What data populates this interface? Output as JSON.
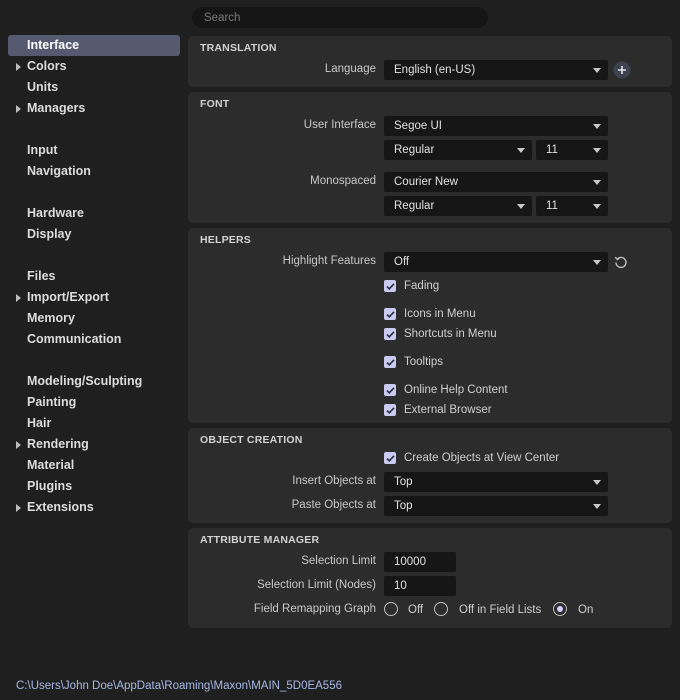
{
  "search": {
    "placeholder": "Search"
  },
  "sidebar": {
    "items": [
      {
        "label": "Interface"
      },
      {
        "label": "Colors"
      },
      {
        "label": "Units"
      },
      {
        "label": "Managers"
      },
      {
        "label": "Input"
      },
      {
        "label": "Navigation"
      },
      {
        "label": "Hardware"
      },
      {
        "label": "Display"
      },
      {
        "label": "Files"
      },
      {
        "label": "Import/Export"
      },
      {
        "label": "Memory"
      },
      {
        "label": "Communication"
      },
      {
        "label": "Modeling/Sculpting"
      },
      {
        "label": "Painting"
      },
      {
        "label": "Hair"
      },
      {
        "label": "Rendering"
      },
      {
        "label": "Material"
      },
      {
        "label": "Plugins"
      },
      {
        "label": "Extensions"
      }
    ]
  },
  "translation": {
    "title": "TRANSLATION",
    "language_label": "Language",
    "language_value": "English (en-US)"
  },
  "font": {
    "title": "FONT",
    "ui_label": "User Interface",
    "ui_family": "Segoe UI",
    "ui_style": "Regular",
    "ui_size": "11",
    "mono_label": "Monospaced",
    "mono_family": "Courier New",
    "mono_style": "Regular",
    "mono_size": "11"
  },
  "helpers": {
    "title": "HELPERS",
    "highlight_label": "Highlight Features",
    "highlight_value": "Off",
    "checkboxes": [
      {
        "label": "Fading",
        "checked": true
      },
      {
        "label": "Icons in Menu",
        "checked": true
      },
      {
        "label": "Shortcuts in Menu",
        "checked": true
      },
      {
        "label": "Tooltips",
        "checked": true
      },
      {
        "label": "Online Help Content",
        "checked": true
      },
      {
        "label": "External Browser",
        "checked": true
      }
    ]
  },
  "object_creation": {
    "title": "OBJECT CREATION",
    "view_center_label": "Create Objects at View Center",
    "view_center_checked": true,
    "insert_label": "Insert Objects at",
    "insert_value": "Top",
    "paste_label": "Paste Objects at",
    "paste_value": "Top"
  },
  "attribute_manager": {
    "title": "ATTRIBUTE MANAGER",
    "selection_limit_label": "Selection Limit",
    "selection_limit_value": "10000",
    "selection_limit_nodes_label": "Selection Limit (Nodes)",
    "selection_limit_nodes_value": "10",
    "remap_label": "Field Remapping Graph",
    "remap_options": [
      {
        "label": "Off",
        "selected": false
      },
      {
        "label": "Off in Field Lists",
        "selected": false
      },
      {
        "label": "On",
        "selected": true
      }
    ]
  },
  "footer": {
    "path": "C:\\Users\\John Doe\\AppData\\Roaming\\Maxon\\MAIN_5D0EA556"
  },
  "colors": {
    "accent": "#565a70",
    "checkbox": "#c9cbf0",
    "path_text": "#a9b8e6"
  },
  "icons": [
    "plus-icon",
    "reset-icon",
    "check-icon",
    "expand-arrow-icon",
    "caret-down-icon"
  ]
}
